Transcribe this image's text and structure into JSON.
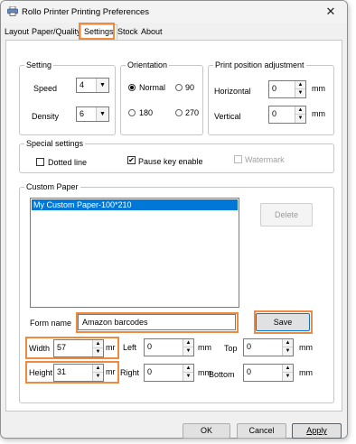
{
  "window": {
    "title": "Rollo Printer Printing Preferences"
  },
  "tabs": [
    "Layout",
    "Paper/Quality",
    "Settings",
    "Stock",
    "About"
  ],
  "setting": {
    "legend": "Setting",
    "speed_label": "Speed",
    "speed_value": "4",
    "density_label": "Density",
    "density_value": "6"
  },
  "orientation": {
    "legend": "Orientation",
    "options": [
      "Normal",
      "90",
      "180",
      "270"
    ],
    "selected": "Normal"
  },
  "print_position": {
    "legend": "Print position adjustment",
    "horizontal_label": "Horizontal",
    "horizontal_value": "0",
    "vertical_label": "Vertical",
    "vertical_value": "0",
    "unit": "mm"
  },
  "special": {
    "legend": "Special settings",
    "dotted_line": "Dotted line",
    "pause_key": "Pause key enable",
    "watermark": "Watermark"
  },
  "custom_paper": {
    "legend": "Custom Paper",
    "list_items": [
      "My Custom Paper-100*210"
    ],
    "delete_label": "Delete",
    "form_name_label": "Form name",
    "form_name_value": "Amazon barcodes",
    "save_label": "Save",
    "width_label": "Width",
    "width_value": "57",
    "width_unit": "mr",
    "height_label": "Height",
    "height_value": "31",
    "height_unit": "mr",
    "left_label": "Left",
    "left_value": "0",
    "left_unit": "mm",
    "right_label": "Right",
    "right_value": "0",
    "right_unit": "mm",
    "top_label": "Top",
    "top_value": "0",
    "top_unit": "mm",
    "bottom_label": "Bottom",
    "bottom_value": "0",
    "bottom_unit": "mm"
  },
  "footer": {
    "ok": "OK",
    "cancel": "Cancel",
    "apply": "Apply"
  },
  "colors": {
    "highlight": "#f08a3e",
    "selection": "#0078d7"
  }
}
